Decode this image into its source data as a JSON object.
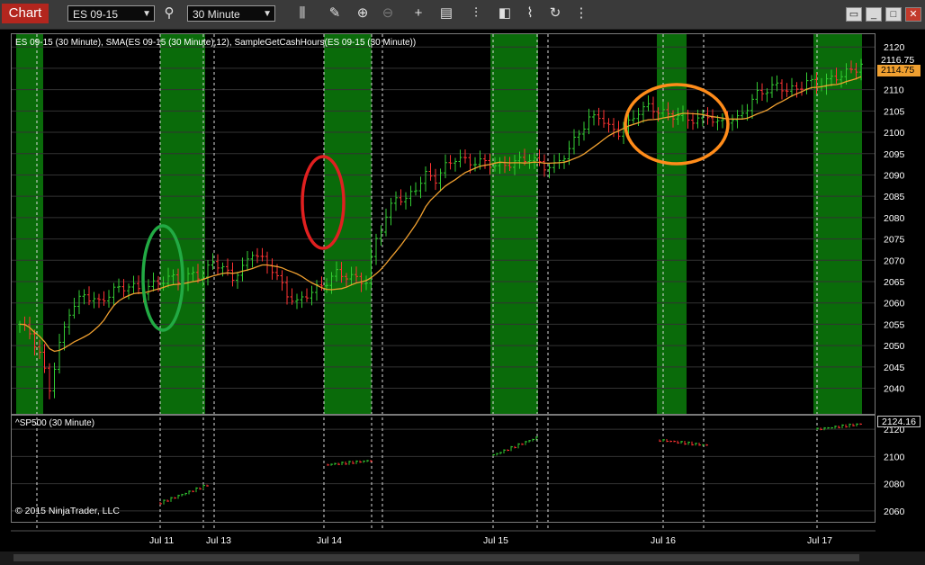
{
  "toolbar": {
    "chart_tab": "Chart",
    "instrument": "ES 09-15",
    "period": "30 Minute",
    "icons": [
      "search-icon",
      "bar-type-icon",
      "draw-pencil-icon",
      "zoom-in-icon",
      "zoom-out-icon",
      "crosshair-icon",
      "data-box-icon",
      "indicators-icon",
      "strategies-icon",
      "drawing-tools-icon",
      "reload-icon"
    ]
  },
  "price_panel": {
    "title": "ES 09-15 (30 Minute), SMA(ES 09-15 (30 Minute),12), SampleGetCashHours(ES 09-15 (30 Minute))",
    "last_price": "2116.75",
    "sma_value": "2114.75"
  },
  "indicator_panel": {
    "title": "^SP500 (30 Minute)",
    "last_price": "2124.16",
    "copyright": "© 2015 NinjaTrader, LLC"
  },
  "x_labels": [
    "Jul 11",
    "Jul 13",
    "Jul 14",
    "Jul 15",
    "Jul 16",
    "Jul 17"
  ],
  "colors": {
    "cash_hours_fill": "#0a6b0a",
    "up_bar": "#33cc33",
    "down_bar": "#ff3333",
    "sma": "#f0a030",
    "green_marker": "#22aa44",
    "red_marker": "#e02020",
    "orange_marker": "#ff8c1a",
    "tab_red": "#b3261e"
  },
  "chart_data": [
    {
      "type": "bar",
      "name_shown": "ES 09-15 (30 Minute)",
      "ylim": [
        2034,
        2123
      ],
      "y_ticks": [
        2040,
        2045,
        2050,
        2055,
        2060,
        2065,
        2070,
        2075,
        2080,
        2085,
        2090,
        2095,
        2100,
        2105,
        2110,
        2115,
        2120
      ],
      "series_close_path": [
        [
          0,
          2055
        ],
        [
          2,
          2053
        ],
        [
          4,
          2048
        ],
        [
          6,
          2040
        ],
        [
          8,
          2050
        ],
        [
          10,
          2058
        ],
        [
          13,
          2062
        ],
        [
          16,
          2060
        ],
        [
          19,
          2063
        ],
        [
          22,
          2064
        ],
        [
          25,
          2063
        ],
        [
          28,
          2065
        ],
        [
          31,
          2066
        ],
        [
          33,
          2065
        ],
        [
          35,
          2067
        ],
        [
          37,
          2066
        ],
        [
          39,
          2070
        ],
        [
          41,
          2068
        ],
        [
          43,
          2066
        ],
        [
          45,
          2068
        ],
        [
          47,
          2072
        ],
        [
          49,
          2070
        ],
        [
          51,
          2068
        ],
        [
          54,
          2062
        ],
        [
          56,
          2060
        ],
        [
          58,
          2062
        ],
        [
          61,
          2064
        ],
        [
          64,
          2067
        ],
        [
          67,
          2066
        ],
        [
          70,
          2065
        ],
        [
          72,
          2075
        ],
        [
          74,
          2080
        ],
        [
          76,
          2085
        ],
        [
          78,
          2084
        ],
        [
          80,
          2087
        ],
        [
          82,
          2090
        ],
        [
          84,
          2089
        ],
        [
          86,
          2092
        ],
        [
          88,
          2094
        ],
        [
          91,
          2093
        ],
        [
          94,
          2093
        ],
        [
          97,
          2092
        ],
        [
          100,
          2093
        ],
        [
          103,
          2094
        ],
        [
          106,
          2092
        ],
        [
          108,
          2092
        ],
        [
          111,
          2096
        ],
        [
          113,
          2100
        ],
        [
          115,
          2103
        ],
        [
          117,
          2104
        ],
        [
          119,
          2101
        ],
        [
          121,
          2100
        ],
        [
          123,
          2102
        ],
        [
          125,
          2105
        ],
        [
          127,
          2106
        ],
        [
          129,
          2105
        ],
        [
          131,
          2104
        ],
        [
          133,
          2104
        ],
        [
          135,
          2103
        ],
        [
          137,
          2103
        ],
        [
          139,
          2104
        ],
        [
          141,
          2102
        ],
        [
          143,
          2103
        ],
        [
          145,
          2103
        ],
        [
          147,
          2106
        ],
        [
          149,
          2109
        ],
        [
          151,
          2110
        ],
        [
          153,
          2111
        ],
        [
          155,
          2110
        ],
        [
          157,
          2110
        ],
        [
          159,
          2112
        ],
        [
          161,
          2111
        ],
        [
          163,
          2112
        ],
        [
          165,
          2113
        ],
        [
          167,
          2114
        ],
        [
          169,
          2115
        ],
        [
          171,
          2117
        ]
      ]
    },
    {
      "type": "bar",
      "name_shown": "^SP500 (30 Minute)",
      "ylim": [
        2052,
        2130
      ],
      "y_ticks": [
        2060,
        2080,
        2100,
        2120
      ]
    }
  ]
}
